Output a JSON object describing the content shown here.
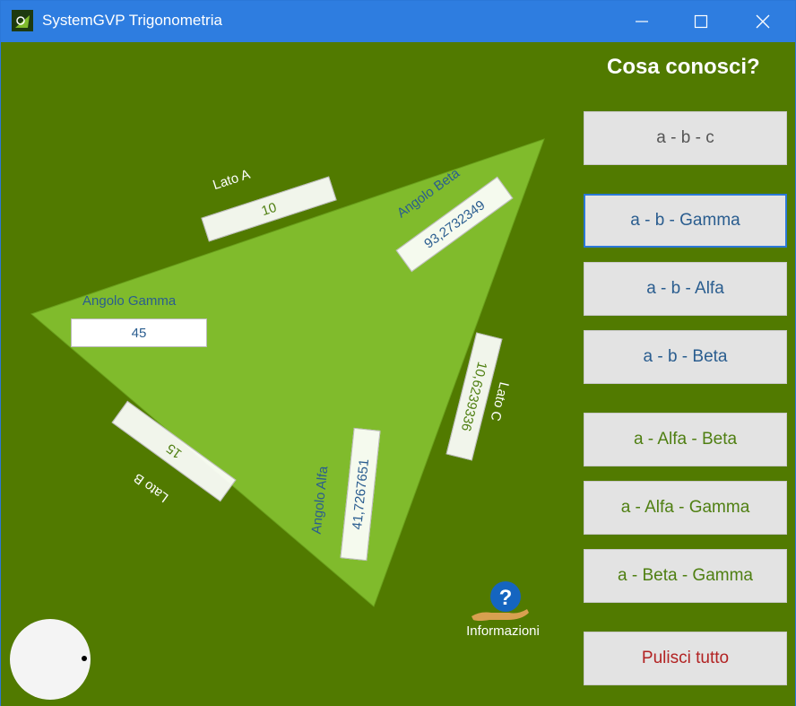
{
  "window": {
    "title": "SystemGVP Trigonometria"
  },
  "controls": {
    "minimize": "minimize-icon",
    "maximize": "maximize-icon",
    "close": "close-icon"
  },
  "panel": {
    "heading": "Cosa conosci?",
    "buttons": [
      "a - b - c",
      "a - b - Gamma",
      "a - b - Alfa",
      "a - b - Beta",
      "a - Alfa - Beta",
      "a - Alfa - Gamma",
      "a - Beta - Gamma"
    ],
    "clear": "Pulisci tutto"
  },
  "triangle": {
    "lato_a": {
      "label": "Lato A",
      "value": "10"
    },
    "lato_b": {
      "label": "Lato B",
      "value": "15"
    },
    "lato_c": {
      "label": "Lato C",
      "value": "10,6239336"
    },
    "angolo_alfa": {
      "label": "Angolo Alfa",
      "value": "41,7267651"
    },
    "angolo_beta": {
      "label": "Angolo Beta",
      "value": "93,2732349"
    },
    "angolo_gamma": {
      "label": "Angolo Gamma",
      "value": "45"
    }
  },
  "info": {
    "label": "Informazioni"
  },
  "colors": {
    "background": "#517a00",
    "triangle": "#80bb2c",
    "titlebar": "#2e7de0"
  }
}
